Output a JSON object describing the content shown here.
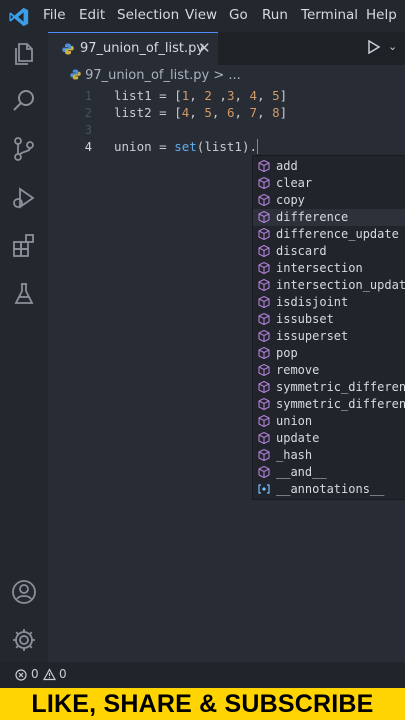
{
  "menu": [
    "File",
    "Edit",
    "Selection",
    "View",
    "Go",
    "Run",
    "Terminal",
    "Help"
  ],
  "tab": {
    "label": "97_union_of_list.py",
    "close": "✕"
  },
  "breadcrumb": {
    "file": "97_union_of_list.py",
    "sep": ">",
    "more": "..."
  },
  "editor": {
    "lines": [
      "1",
      "2",
      "3",
      "4"
    ],
    "active_line": "4",
    "code": {
      "l1": {
        "name": "list1",
        "eq": " = [",
        "v": [
          "1",
          "2",
          "3",
          "4",
          "5"
        ]
      },
      "l2": {
        "name": "list2",
        "eq": " = [",
        "v": [
          "4",
          "5",
          "6",
          "7",
          "8"
        ]
      },
      "l4": {
        "name": "union",
        "eq": " = ",
        "fn": "set",
        "arg": "list1",
        "tail": "."
      }
    }
  },
  "suggestions": [
    "add",
    "clear",
    "copy",
    "difference",
    "difference_update",
    "discard",
    "intersection",
    "intersection_update",
    "isdisjoint",
    "issubset",
    "issuperset",
    "pop",
    "remove",
    "symmetric_difference",
    "symmetric_difference_update",
    "union",
    "update",
    "_hash",
    "__and__",
    "__annotations__"
  ],
  "selected_suggestion": "difference",
  "status": {
    "errors": "0",
    "warnings": "0"
  },
  "banner": "LIKE, SHARE & SUBSCRIBE",
  "colors": {
    "accent": "#528bff",
    "method_icon": "#b180d7",
    "banner_bg": "#ffd400"
  }
}
